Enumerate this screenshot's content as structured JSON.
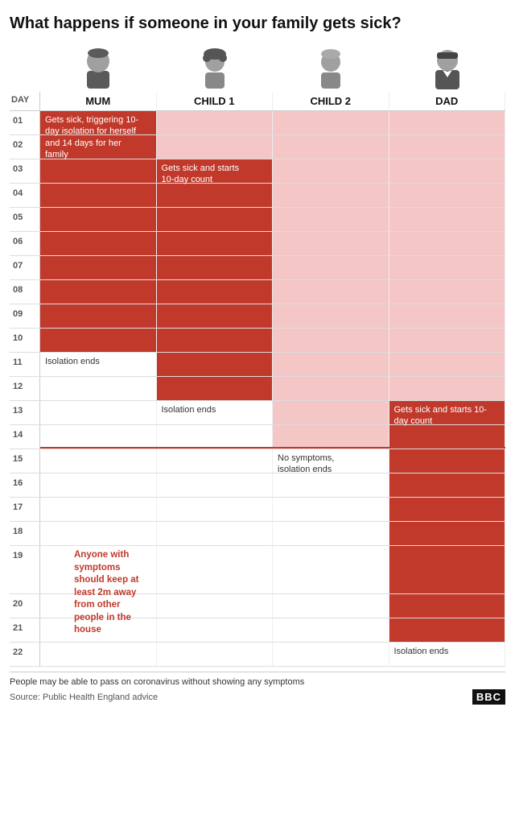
{
  "title": "What happens if someone in your family gets sick?",
  "columns": [
    "MUM",
    "CHILD 1",
    "CHILD 2",
    "DAD"
  ],
  "day_label": "DAY",
  "days": [
    "01",
    "02",
    "03",
    "04",
    "05",
    "06",
    "07",
    "08",
    "09",
    "10",
    "11",
    "12",
    "13",
    "14",
    "15",
    "16",
    "17",
    "18",
    "19",
    "20",
    "21",
    "22"
  ],
  "mum_label": "Gets sick, triggering 10-day isolation for herself and 14 days for her family",
  "mum_iso_end": "Isolation ends",
  "child1_label": "Gets sick and starts 10-day count",
  "child1_iso_end": "Isolation ends",
  "child2_iso_end": "No symptoms, isolation ends",
  "dad_label": "Gets sick and starts 10-day count",
  "dad_iso_end": "Isolation ends",
  "annotation": "Anyone with symptoms should keep at least 2m away from other people in the house",
  "footer_note": "People may be able to pass on coronavirus without showing any symptoms",
  "footer_source": "Source: Public Health England advice",
  "bbc": "BBC",
  "colors": {
    "red": "#c0392b",
    "pink": "#f5c6c6",
    "white": "#ffffff"
  }
}
